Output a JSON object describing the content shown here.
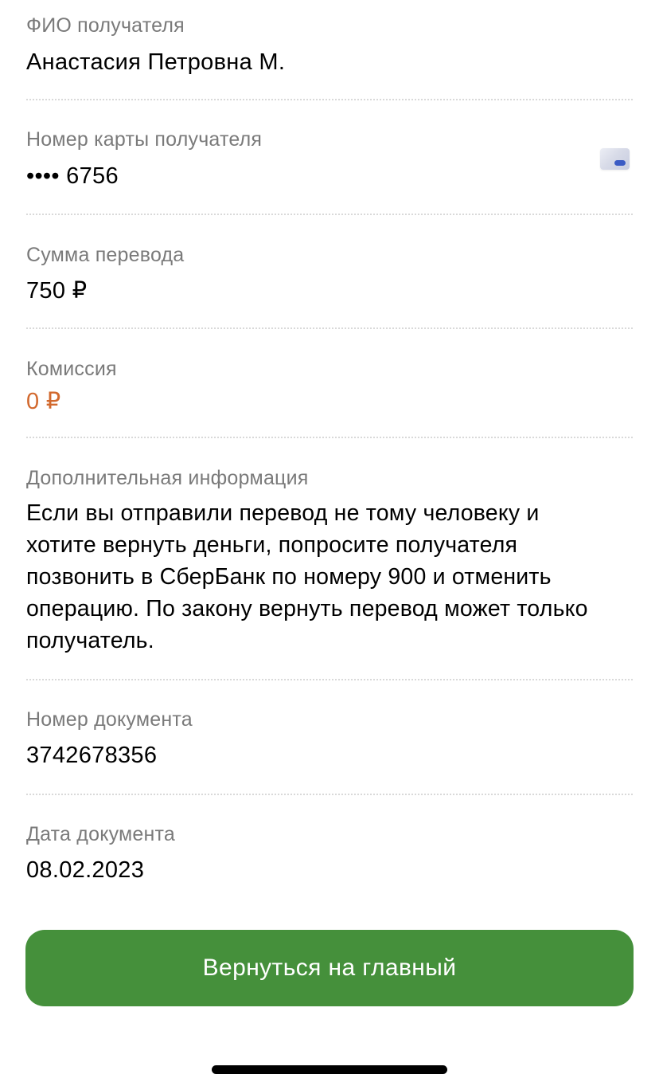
{
  "fields": {
    "recipient_name": {
      "label": "ФИО получателя",
      "value": "Анастасия Петровна М."
    },
    "card_number": {
      "label": "Номер карты получателя",
      "value": "•••• 6756",
      "icon": "bank-card-icon"
    },
    "amount": {
      "label": "Сумма перевода",
      "value": "750 ₽"
    },
    "commission": {
      "label": "Комиссия",
      "value": "0 ₽"
    },
    "additional_info": {
      "label": "Дополнительная информация",
      "value": "Если вы отправили перевод не тому человеку и хотите вернуть деньги, попросите получателя позвонить в СберБанк по номеру 900 и отменить операцию. По закону вернуть перевод может только получатель."
    },
    "document_number": {
      "label": "Номер документа",
      "value": "3742678356"
    },
    "document_date": {
      "label": "Дата документа",
      "value": "08.02.2023"
    }
  },
  "actions": {
    "back_home_label": "Вернуться на главный"
  },
  "colors": {
    "label": "#7a7a7a",
    "value": "#000000",
    "commission_accent": "#d2692e",
    "button_bg": "#45903b",
    "button_text": "#ffffff",
    "divider": "#d9d9d9"
  }
}
